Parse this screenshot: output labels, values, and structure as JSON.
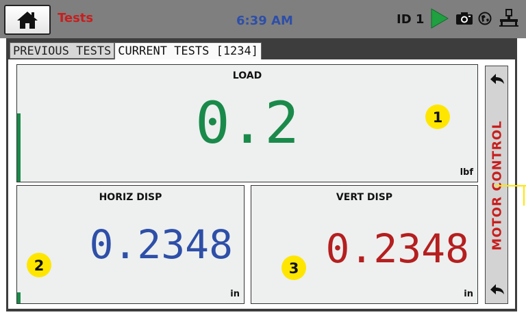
{
  "header": {
    "title": "Tests",
    "time": "6:39 AM",
    "device_id": "ID 1",
    "icons": [
      "home-icon",
      "play-icon",
      "camera-icon",
      "network-icon",
      "connection-icon"
    ]
  },
  "tabs": [
    {
      "label": "PREVIOUS TESTS",
      "active": false
    },
    {
      "label": "CURRENT TESTS [1234]",
      "active": true
    }
  ],
  "panels": {
    "load": {
      "label": "LOAD",
      "value": "0.2",
      "unit": "lbf",
      "badge": "1",
      "color": "#1a8a4a"
    },
    "horiz": {
      "label": "HORIZ DISP",
      "value": "0.2348",
      "unit": "in",
      "badge": "2",
      "color": "#2e4fa8"
    },
    "vert": {
      "label": "VERT DISP",
      "value": "0.2348",
      "unit": "in",
      "badge": "3",
      "color": "#b51f1f"
    }
  },
  "sidebar": {
    "label": "MOTOR CONTROL"
  }
}
